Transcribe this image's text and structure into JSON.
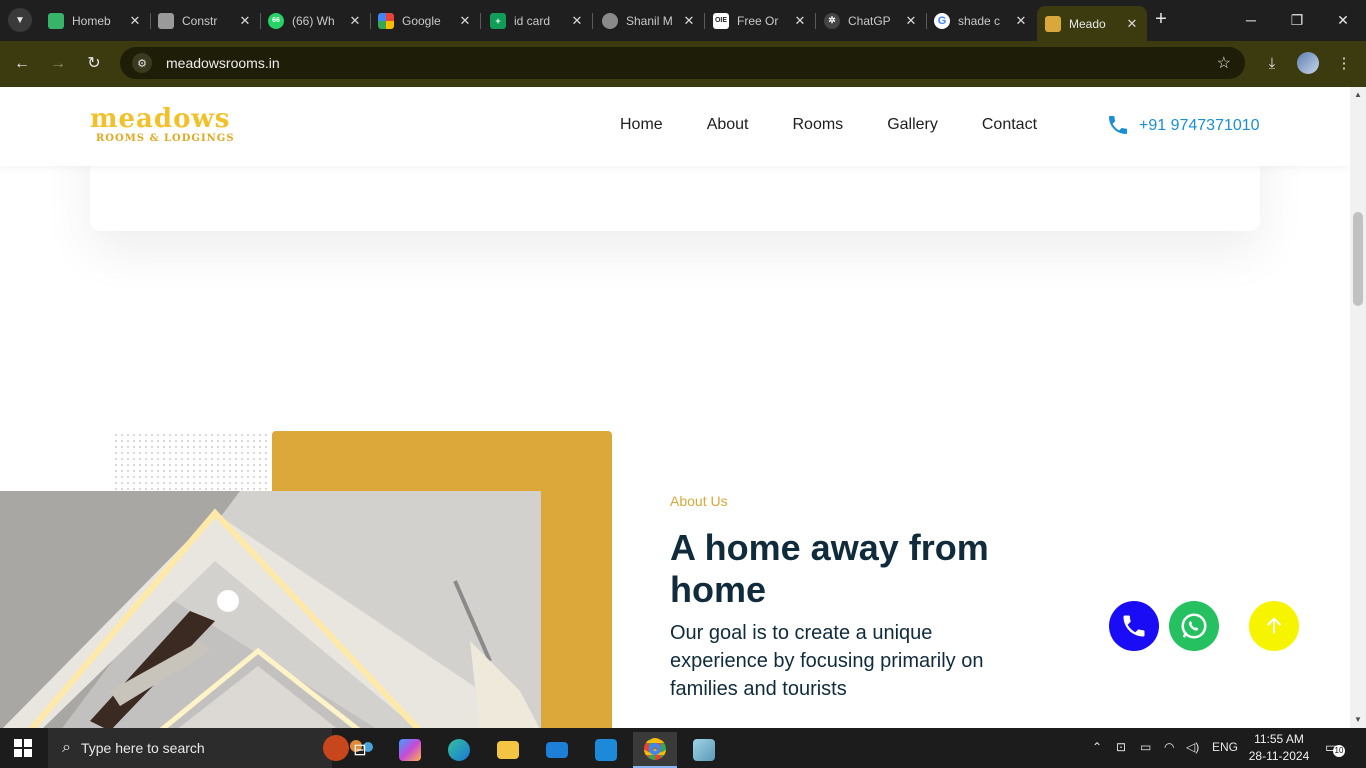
{
  "browser": {
    "tabs": [
      {
        "title": "Homeb",
        "favicon": "green-leaf-icon",
        "color": "#38b36a",
        "active": false
      },
      {
        "title": "Constr",
        "favicon": "card-icon",
        "color": "#9a9a9a",
        "active": false
      },
      {
        "title": "(66) Wh",
        "favicon": "whatsapp-icon",
        "color": "#25d366",
        "badge": "66",
        "active": false
      },
      {
        "title": "Google",
        "favicon": "google-meet-icon",
        "color": "#1a73e8",
        "active": false
      },
      {
        "title": "id card",
        "favicon": "google-sheets-icon",
        "color": "#0f9d58",
        "active": false
      },
      {
        "title": "Shanil M",
        "favicon": "globe-icon",
        "color": "#8a8a8a",
        "active": false
      },
      {
        "title": "Free Or",
        "favicon": "oie-icon",
        "color": "#ffffff",
        "active": false
      },
      {
        "title": "ChatGP",
        "favicon": "chatgpt-icon",
        "color": "#444444",
        "active": false
      },
      {
        "title": "shade c",
        "favicon": "google-icon",
        "color": "#4285f4",
        "active": false
      },
      {
        "title": "Meado",
        "favicon": "meadows-icon",
        "color": "#d9a83a",
        "active": true
      }
    ],
    "url": "meadowsrooms.in"
  },
  "site": {
    "logo": {
      "main": "meadows",
      "sub": "ROOMS & LODGINGS"
    },
    "nav": [
      "Home",
      "About",
      "Rooms",
      "Gallery",
      "Contact"
    ],
    "phone": "+91 9747371010",
    "about": {
      "label": "About Us",
      "title": "A home away from home",
      "text": "Our goal is to create a unique experience by focusing primarily on families and tourists"
    }
  },
  "taskbar": {
    "search_placeholder": "Type here to search",
    "language": "ENG",
    "time": "11:55 AM",
    "date": "28-11-2024",
    "notifications": "10"
  },
  "colors": {
    "accent_gold": "#dca83a",
    "logo_yellow": "#f2c12a",
    "heading_navy": "#0f2b3c",
    "phone_blue": "#1a8fd6",
    "call_button": "#1a0df5",
    "whatsapp_button": "#25c160",
    "top_button": "#f7f400"
  }
}
